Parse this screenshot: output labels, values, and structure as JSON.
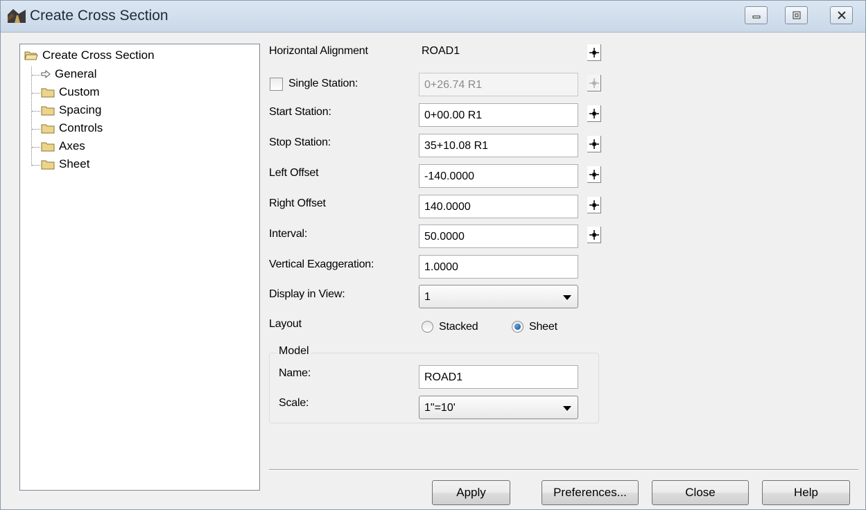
{
  "window": {
    "title": "Create Cross Section",
    "icon": "road-icon"
  },
  "tree": {
    "root": "Create Cross Section",
    "items": [
      {
        "label": "General",
        "selected": true
      },
      {
        "label": "Custom"
      },
      {
        "label": "Spacing"
      },
      {
        "label": "Controls"
      },
      {
        "label": "Axes"
      },
      {
        "label": "Sheet"
      }
    ]
  },
  "form": {
    "horizontal_alignment_label": "Horizontal Alignment",
    "horizontal_alignment_value": "ROAD1",
    "single_station_label": "Single Station:",
    "single_station_value": "0+26.74 R1",
    "start_station_label": "Start Station:",
    "start_station_value": "0+00.00 R1",
    "stop_station_label": "Stop Station:",
    "stop_station_value": "35+10.08 R1",
    "left_offset_label": "Left Offset",
    "left_offset_value": "-140.0000",
    "right_offset_label": "Right Offset",
    "right_offset_value": "140.0000",
    "interval_label": "Interval:",
    "interval_value": "50.0000",
    "vert_exag_label": "Vertical Exaggeration:",
    "vert_exag_value": "1.0000",
    "display_view_label": "Display in View:",
    "display_view_value": "1",
    "layout_label": "Layout",
    "layout_stacked": "Stacked",
    "layout_sheet": "Sheet",
    "layout_selected": "Sheet"
  },
  "model": {
    "legend": "Model",
    "name_label": "Name:",
    "name_value": "ROAD1",
    "scale_label": "Scale:",
    "scale_value": "1\"=10'"
  },
  "buttons": {
    "apply": "Apply",
    "preferences": "Preferences...",
    "close": "Close",
    "help": "Help"
  }
}
